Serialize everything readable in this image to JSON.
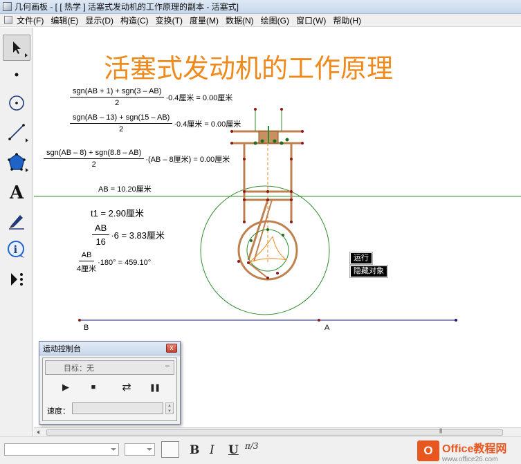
{
  "window": {
    "title": "几何画板 - [ [ 热学 ] 活塞式发动机的工作原理的副本 - 活塞式]"
  },
  "menu": [
    "文件(F)",
    "编辑(E)",
    "显示(D)",
    "构造(C)",
    "变换(T)",
    "度量(M)",
    "数据(N)",
    "绘图(G)",
    "窗口(W)",
    "帮助(H)"
  ],
  "tools": [
    "arrow-select-icon",
    "point-tool-icon",
    "compass-tool-icon",
    "straightedge-tool-icon",
    "polygon-tool-icon",
    "text-tool-icon",
    "marker-tool-icon",
    "information-tool-icon",
    "custom-tool-icon"
  ],
  "document": {
    "title": "活塞式发动机的工作原理"
  },
  "formulas": {
    "f1": {
      "num": "sgn(AB + 1) + sgn(3 – AB)",
      "den": "2",
      "rest": "·0.4厘米 = 0.00厘米"
    },
    "f2": {
      "num": "sgn(AB – 13) + sgn(15 – AB)",
      "den": "2",
      "rest": "·0.4厘米 = 0.00厘米"
    },
    "f3": {
      "num": "sgn(AB – 8) + sgn(8.8 – AB)",
      "den": "2",
      "rest": "·(AB – 8厘米) = 0.00厘米"
    },
    "ab": "AB = 10.20厘米",
    "t1": "t1 = 2.90厘米",
    "f5": {
      "num": "AB",
      "den": "16",
      "rest": "·6 = 3.83厘米"
    },
    "f6": {
      "num": "AB",
      "den": "4厘米",
      "rest": "·180° = 459.10°"
    }
  },
  "labels": {
    "b": "B",
    "a": "A"
  },
  "buttons": {
    "run": "运行",
    "hide": "隐藏对象"
  },
  "motion": {
    "title": "运动控制台",
    "close": "x",
    "target": "目标：无",
    "minus": "–",
    "play": "▶",
    "stop": "■",
    "direction": "⇄",
    "pause": "❚❚",
    "speed_label": "速度：",
    "speed_value": ""
  },
  "textbar": {
    "font": "",
    "size": "",
    "bold": "B",
    "italic": "I",
    "underline": "U",
    "math": "π/3"
  },
  "brand": {
    "name": "Office教程网",
    "url": "www.office26.com"
  },
  "colors": {
    "title_orange": "#ee8a1c",
    "mechanism_brown": "#c08150",
    "circle_green": "#2e8b2e",
    "segment_navy": "#1a1a7a",
    "point_red": "#8b1a1a"
  }
}
